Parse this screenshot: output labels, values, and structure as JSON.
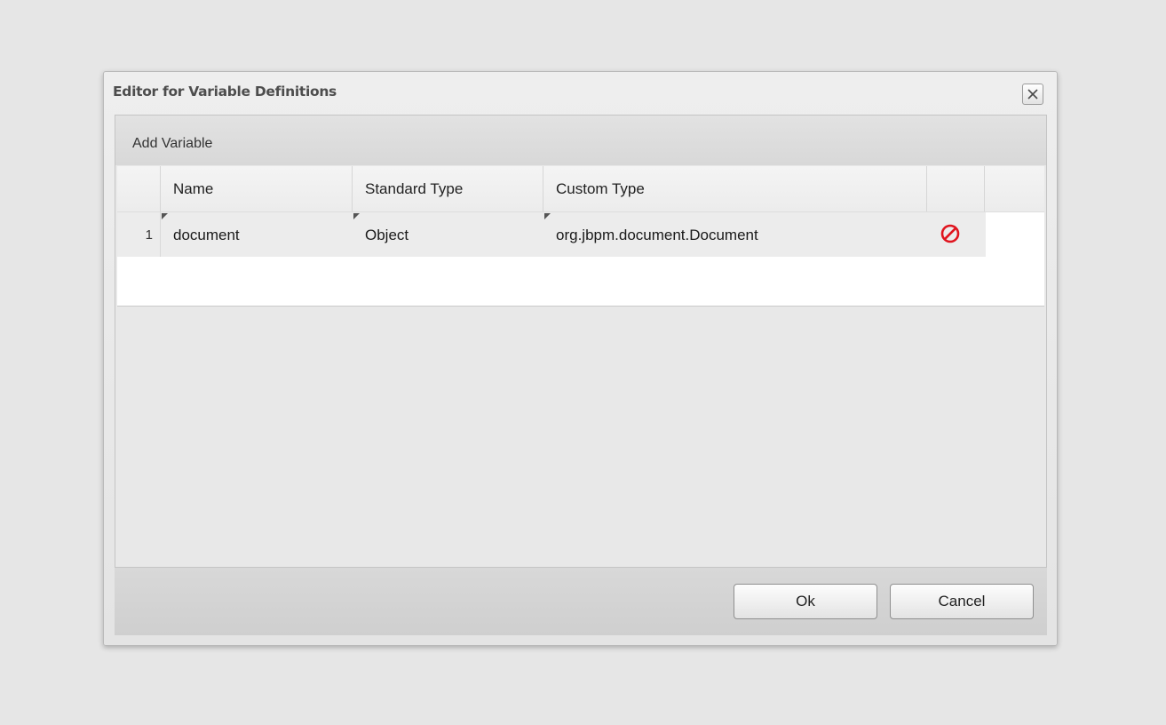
{
  "dialog": {
    "title": "Editor for Variable Definitions",
    "close_icon": "close-x-icon"
  },
  "toolbar": {
    "add_variable_label": "Add Variable"
  },
  "grid": {
    "columns": [
      "",
      "Name",
      "Standard Type",
      "Custom Type",
      "",
      ""
    ],
    "rows": [
      {
        "row_number": "1",
        "name": "document",
        "standard_type": "Object",
        "custom_type": "org.jbpm.document.Document",
        "action_icon": "delete-prohibited-icon"
      }
    ]
  },
  "buttons": {
    "ok_label": "Ok",
    "cancel_label": "Cancel"
  },
  "colors": {
    "delete_icon": "#e0141e",
    "background": "#e6e6e6"
  }
}
